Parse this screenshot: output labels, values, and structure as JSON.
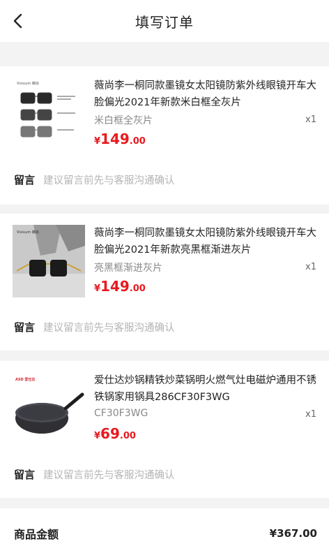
{
  "header": {
    "title": "填写订单"
  },
  "items": [
    {
      "name": "薇尚李一桐同款墨镜女太阳镜防紫外线眼镜开车大脸偏光2021年新款米白框全灰片",
      "spec": "米白框全灰片",
      "qty": "x1",
      "price_currency": "¥",
      "price_int": "149",
      "price_dec": ".00",
      "thumb_brand": "Vixiuum 薇尚"
    },
    {
      "name": "薇尚李一桐同款墨镜女太阳镜防紫外线眼镜开车大脸偏光2021年新款亮黑框渐进灰片",
      "spec": "亮黑框渐进灰片",
      "qty": "x1",
      "price_currency": "¥",
      "price_int": "149",
      "price_dec": ".00",
      "thumb_brand": "Vixiuum 薇尚"
    },
    {
      "name": "爱仕达炒锅精铁炒菜锅明火燃气灶电磁炉通用不锈铁锅家用锅具286CF30F3WG",
      "spec": "CF30F3WG",
      "qty": "x1",
      "price_currency": "¥",
      "price_int": "69",
      "price_dec": ".00",
      "thumb_brand": "ASD 爱仕达"
    }
  ],
  "message": {
    "label": "留言",
    "placeholder": "建议留言前先与客服沟通确认"
  },
  "summary": {
    "label": "商品金额",
    "value": "¥367.00"
  },
  "colors": {
    "price_red": "#e8191f",
    "bg_gray": "#f3f3f3"
  },
  "icons": {
    "back": "chevron-left-icon"
  }
}
